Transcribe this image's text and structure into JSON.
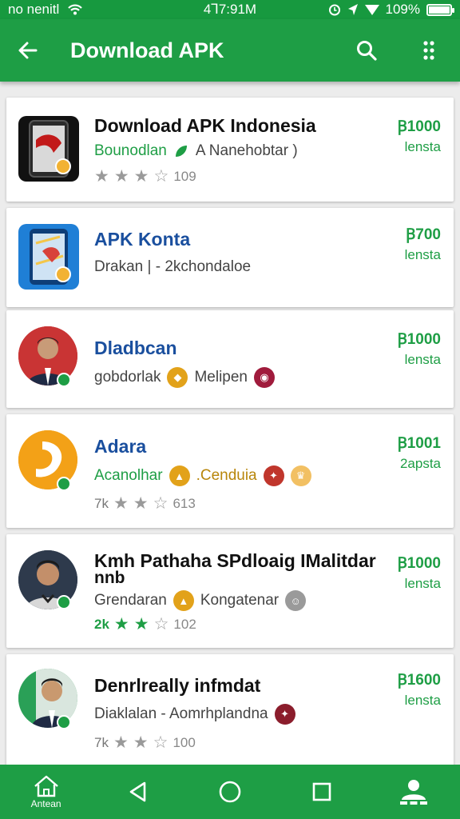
{
  "status_bar": {
    "carrier": "no nenitl",
    "time": "4Ꞁ7:91M",
    "battery": "109%",
    "battery_level": 1.0,
    "icons": [
      "wifi-icon",
      "alarm-icon",
      "location-icon",
      "signal-icon",
      "battery-icon"
    ]
  },
  "app_bar": {
    "title": "Download APK",
    "back_icon": "back-arrow-icon",
    "search_icon": "search-icon",
    "menu_icon": "more-vert-icon"
  },
  "items": [
    {
      "name": "Download APK Indonesia",
      "subtitle_green": "Bounodlan",
      "subtitle": "A Nanehobtar )",
      "rating_text": "109",
      "stars_filled": 3,
      "price": "Ꞵ1000",
      "price_label": "lensta"
    },
    {
      "name": "APK Konta",
      "subtitle": "Drakan | - 2kchondaloe",
      "price": "Ꞵ700",
      "price_label": "lensta"
    },
    {
      "name": "Dladbcan",
      "subtitle": "gobdorlak",
      "subtitle2": "Melipen",
      "price": "Ꞵ1000",
      "price_label": "lensta"
    },
    {
      "name": "Adara",
      "subtitle_green": "Acanolhar",
      "subtitle2": ".Cenduia",
      "rating_prefix": "7k",
      "rating_text": "613",
      "stars_filled": 2,
      "price": "Ꞵ1001",
      "price_label": "2apsta"
    },
    {
      "name": "Kmh Pathaha SPdloaig IMalitdar",
      "name_line2": "nnb",
      "subtitle": "Grendaran",
      "subtitle2": "Kongatenar",
      "rating_prefix": "2k",
      "rating_text": "102",
      "stars_filled": 2,
      "price": "Ꞵ1000",
      "price_label": "lensta"
    },
    {
      "name": "Denrlreally infmdat",
      "subtitle": "Diaklalan  - Aomrhplandna",
      "rating_prefix": "7k",
      "rating_text": "100",
      "stars_filled": 2,
      "price": "Ꞵ1600",
      "price_label": "lensta"
    }
  ],
  "nav_bar": {
    "home_label": "Antean",
    "icons": [
      "home-icon",
      "back-triangle-icon",
      "home-circle-icon",
      "recents-square-icon",
      "account-icon"
    ]
  },
  "colors": {
    "primary": "#1e9e45",
    "status_bar": "#17993f",
    "title_blue": "#1a4f9e",
    "background": "#ececec"
  }
}
